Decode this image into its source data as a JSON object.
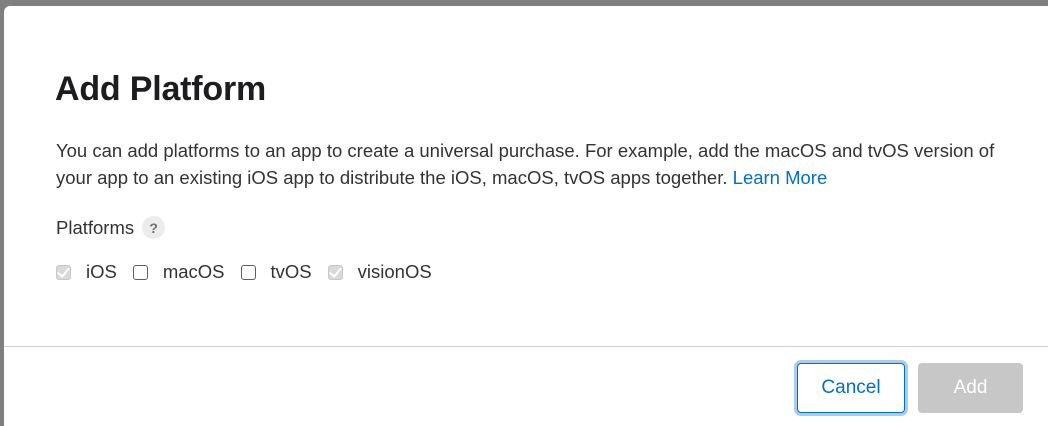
{
  "dialog": {
    "title": "Add Platform",
    "description": "You can add platforms to an app to create a universal purchase. For example, add the macOS and tvOS version of your app to an existing iOS app to distribute the iOS, macOS, tvOS apps together.",
    "learn_more_label": "Learn More",
    "platforms_label": "Platforms",
    "help_icon_glyph": "?",
    "platforms": [
      {
        "label": "iOS",
        "checked": true,
        "disabled": true
      },
      {
        "label": "macOS",
        "checked": false,
        "disabled": false
      },
      {
        "label": "tvOS",
        "checked": false,
        "disabled": false
      },
      {
        "label": "visionOS",
        "checked": true,
        "disabled": true
      }
    ],
    "buttons": {
      "cancel_label": "Cancel",
      "add_label": "Add"
    }
  },
  "colors": {
    "link": "#0070c9",
    "text": "#333336",
    "title": "#1d1d1f",
    "add_button_disabled": "#c7c7c7",
    "backdrop": "#7f7f7f"
  }
}
